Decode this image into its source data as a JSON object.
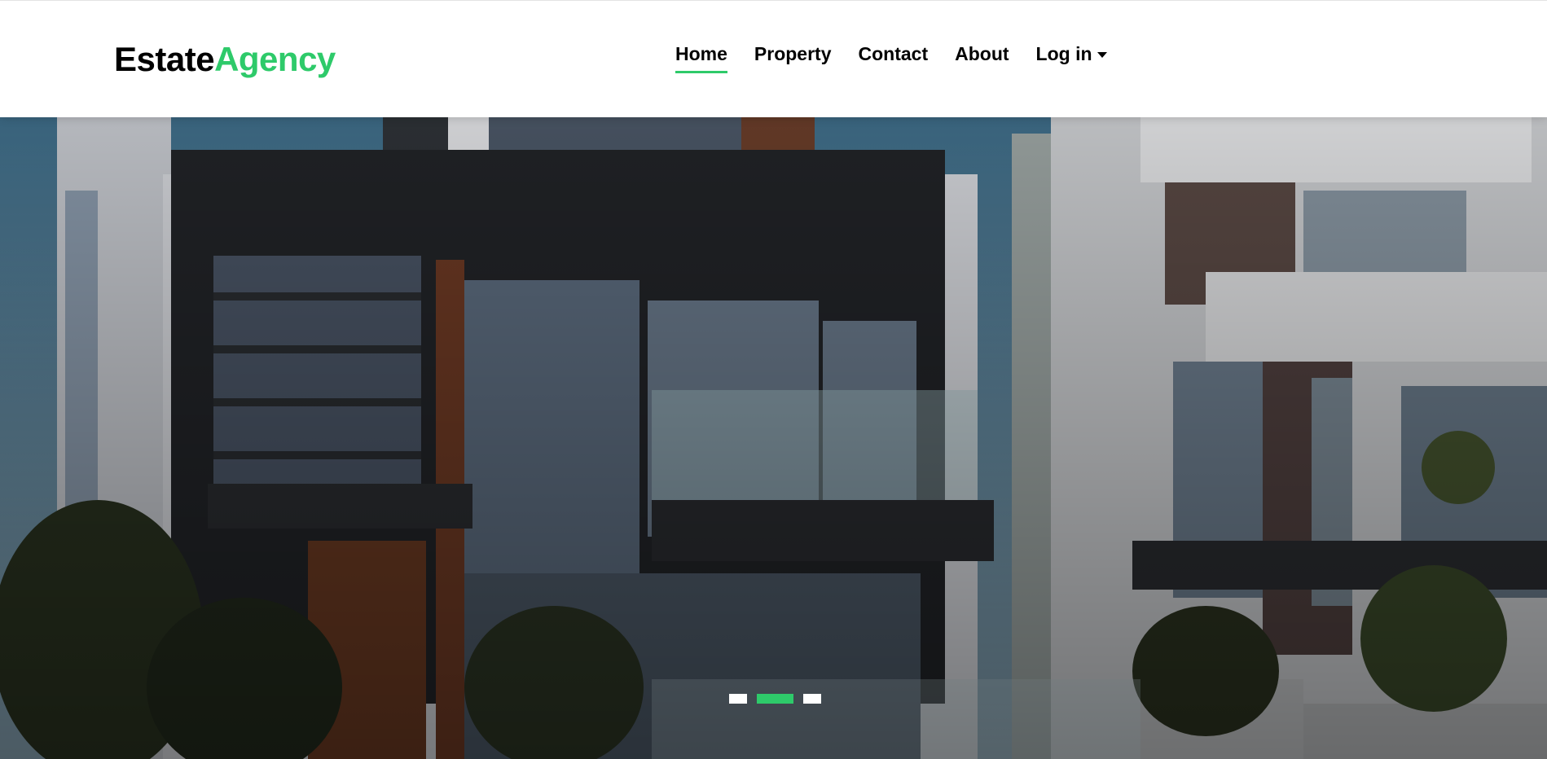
{
  "brand": {
    "part1": "Estate",
    "part2": "Agency"
  },
  "nav": {
    "home": "Home",
    "property": "Property",
    "contact": "Contact",
    "about": "About",
    "login": "Log in"
  },
  "carousel": {
    "slide_count": 3,
    "active_index": 1
  },
  "colors": {
    "accent": "#2eca6a",
    "text": "#000000"
  }
}
